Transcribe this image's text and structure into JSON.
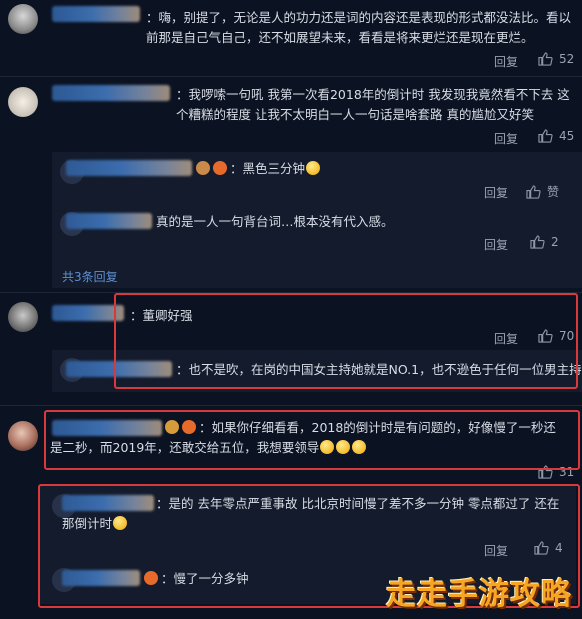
{
  "comments": [
    {
      "text": "：嗨，别提了，无论是人的功力还是词的内容还是表现的形式都没法比。看以前那是自己气自己，还不如展望未来，看看是将来更烂还是现在更烂。",
      "reply_label": "回复",
      "likes": "52"
    },
    {
      "text": "：我啰嗦一句吼 我第一次看2018年的倒计时 我发现我竟然看不下去 这个糟糕的程度 让我不太明白一人一句话是啥套路 真的尴尬又好笑",
      "reply_label": "回复",
      "likes": "45",
      "replies": [
        {
          "text": "：黑色三分钟",
          "reply_label": "回复",
          "likes_label": "赞"
        },
        {
          "text": "真的是一人一句背台词…根本没有代入感。",
          "reply_label": "回复",
          "likes": "2"
        }
      ],
      "expand_label": "共3条回复"
    },
    {
      "text": "：董卿好强",
      "reply_label": "回复",
      "likes": "70",
      "replies": [
        {
          "text": "：也不是吹，在岗的中国女主持她就是NO.1，也不逊色于任何一位男主持"
        }
      ]
    },
    {
      "text": "：如果你仔细看看，2018的倒计时是有问题的，好像慢了一秒还是二秒，而2019年，还敢交给五位，我想要领导",
      "likes": "31"
    },
    {
      "text": "：是的  去年零点严重事故  比北京时间慢了差不多一分钟  零点都过了  还在那倒计时",
      "reply_label": "回复",
      "likes": "4",
      "replies": [
        {
          "text": "：慢了一分多钟"
        }
      ]
    }
  ],
  "watermark": "走走手游攻略",
  "colors": {
    "background": "#0b1222",
    "highlight": "#d63a3a",
    "link": "#5f8fd0"
  }
}
